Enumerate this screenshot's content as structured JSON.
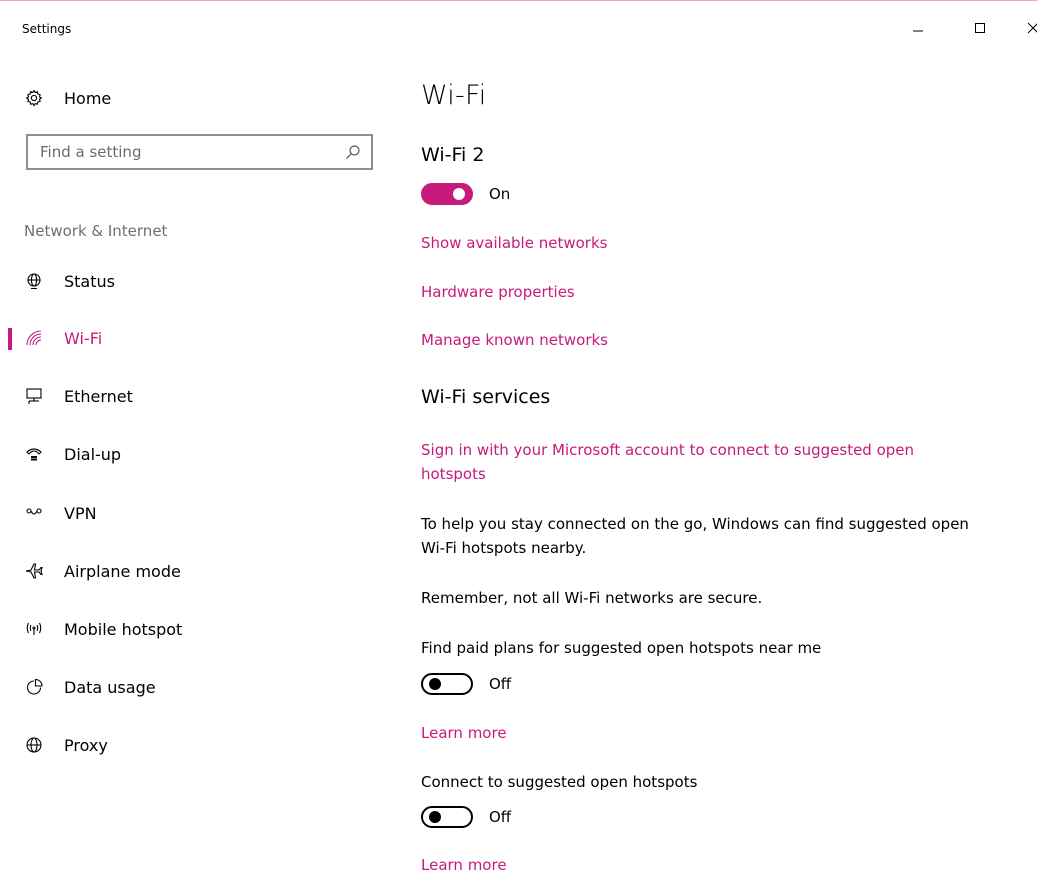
{
  "window": {
    "title": "Settings",
    "minimize_icon": "minimize-icon",
    "maximize_icon": "maximize-icon",
    "close_icon": "close-icon"
  },
  "colors": {
    "accent": "#c71a7c",
    "secondary_text": "#6f6f6f"
  },
  "sidebar": {
    "home_label": "Home",
    "search_placeholder": "Find a setting",
    "section_label": "Network & Internet",
    "items": [
      {
        "label": "Status",
        "icon": "globe-status-icon"
      },
      {
        "label": "Wi-Fi",
        "icon": "wifi-icon",
        "active": true
      },
      {
        "label": "Ethernet",
        "icon": "ethernet-icon"
      },
      {
        "label": "Dial-up",
        "icon": "dialup-icon"
      },
      {
        "label": "VPN",
        "icon": "vpn-icon"
      },
      {
        "label": "Airplane mode",
        "icon": "airplane-icon"
      },
      {
        "label": "Mobile hotspot",
        "icon": "hotspot-icon"
      },
      {
        "label": "Data usage",
        "icon": "data-usage-icon"
      },
      {
        "label": "Proxy",
        "icon": "globe-proxy-icon"
      }
    ]
  },
  "main": {
    "title": "Wi-Fi",
    "adapter_name": "Wi-Fi 2",
    "wifi_toggle_state": "On",
    "links": {
      "show_networks": "Show available networks",
      "hardware_properties": "Hardware properties",
      "manage_networks": "Manage known networks"
    },
    "services": {
      "heading": "Wi-Fi services",
      "sign_in_link": "Sign in with your Microsoft account to connect to suggested open hotspots",
      "help_text": "To help you stay connected on the go, Windows can find suggested open Wi-Fi hotspots nearby.",
      "warning_text": "Remember, not all Wi-Fi networks are secure.",
      "paid_plans_label": "Find paid plans for suggested open hotspots near me",
      "paid_plans_state": "Off",
      "learn_more_1": "Learn more",
      "connect_label": "Connect to suggested open hotspots",
      "connect_state": "Off",
      "learn_more_2": "Learn more"
    }
  }
}
